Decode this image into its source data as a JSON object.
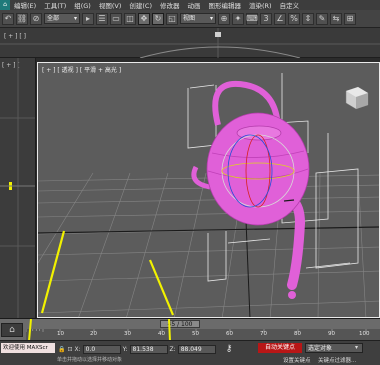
{
  "menubar": {
    "items": [
      "编辑(E)",
      "工具(T)",
      "组(G)",
      "视图(V)",
      "创建(C)",
      "修改器",
      "动画",
      "图形编辑器",
      "渲染(R)",
      "自定义"
    ]
  },
  "toolbar": {
    "selection_filter": "全部",
    "reference_coord": "视图"
  },
  "viewport": {
    "label": "[ + ] [ 透视 ] [ 平滑 + 高光 ]"
  },
  "timeline": {
    "slider_label": "45 / 100",
    "ticks": [
      "10",
      "20",
      "30",
      "40",
      "50",
      "60",
      "70",
      "80",
      "90",
      "100"
    ]
  },
  "statusbar": {
    "maxscript": "欢迎使用 MAXScr",
    "x_label": "X:",
    "x_value": "0.0",
    "y_label": "Y:",
    "y_value": "81.538",
    "z_label": "Z:",
    "z_value": "88.049",
    "autokey_label": "自动关键点",
    "selection_set": "选定对象",
    "hint": "单击并拖动以选择并移动对象",
    "setkey_label": "设置关键点",
    "keyfilter_label": "关键点过滤器..."
  },
  "colors": {
    "teapot": "#e060d8",
    "autokey": "#b81616",
    "annotation_lines": "#f2f200",
    "viewport_bg": "#5c5c5c"
  }
}
